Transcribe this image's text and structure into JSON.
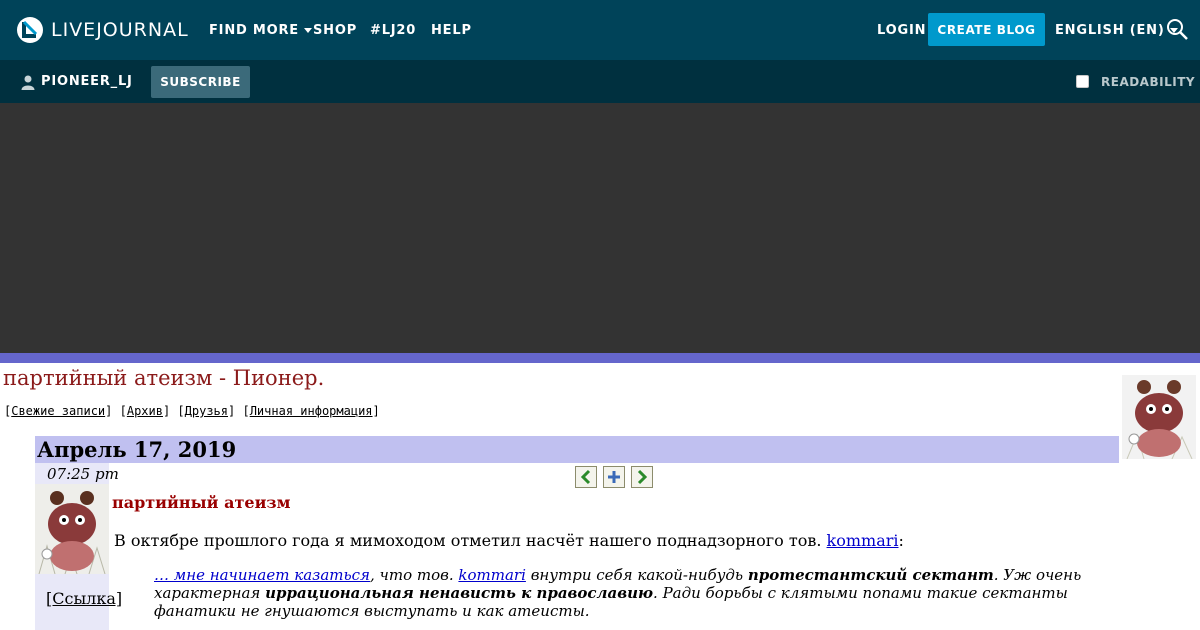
{
  "header": {
    "logo_text": "LIVEJOURNAL",
    "nav": [
      {
        "label": "FIND MORE",
        "has_dropdown": true
      },
      {
        "label": "SHOP",
        "has_dropdown": false
      },
      {
        "label": "#LJ20",
        "has_dropdown": false
      },
      {
        "label": "HELP",
        "has_dropdown": false
      }
    ],
    "login_label": "LOGIN",
    "create_blog_label": "CREATE BLOG",
    "language_label": "ENGLISH (EN)",
    "search_icon": "search-icon",
    "colors": {
      "bar": "#004359",
      "create_button": "#0099cc"
    }
  },
  "subheader": {
    "username": "PIONEER_LJ",
    "user_icon": "user-icon",
    "subscribe_label": "SUBSCRIBE",
    "readability_label": "READABILITY",
    "readability_checked": false,
    "colors": {
      "bar": "#00303f"
    }
  },
  "journal": {
    "title": "партийный атеизм - Пионер.",
    "nav_links": [
      "Свежие записи",
      "Архив",
      "Друзья",
      "Личная информация"
    ],
    "colors": {
      "accent_bar": "#6566cc",
      "title": "#8b1a1a",
      "date_bar": "#c0c0f0"
    }
  },
  "entry": {
    "date": "Апрель 17, 2019",
    "time": "07:25 pm",
    "link_label": "[Ссылка]",
    "nav_icons": [
      "arrow-left-icon",
      "plus-icon",
      "arrow-right-icon"
    ],
    "subject": "партийный атеизм",
    "body_text": "В октябре прошлого года я мимоходом отметил насчёт нашего поднадзорного тов.",
    "body_user": "kommari",
    "body_end": ":",
    "quote": {
      "link1": "… мне начинает казаться",
      "t1": ", что тов.",
      "user": "kommari",
      "t2": "внутри себя какой-нибудь",
      "b1": "протестантский сектант",
      "t3": ". Уж очень характерная",
      "b2": "иррациональная ненависть к православию",
      "t4": ". Ради борьбы с клятыми попами такие сектанты фанатики не гнушаются выступать и как атеисты."
    }
  }
}
